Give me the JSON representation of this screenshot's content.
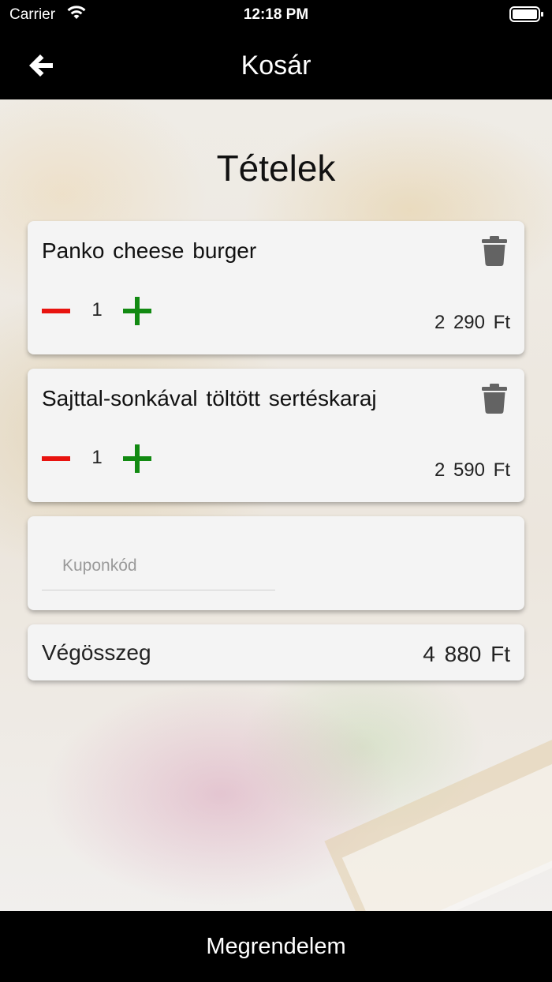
{
  "status": {
    "carrier": "Carrier",
    "time": "12:18 PM"
  },
  "navbar": {
    "title": "Kosár",
    "back_icon": "arrow-left-icon"
  },
  "cart": {
    "title": "Tételek",
    "items": [
      {
        "name": "Panko cheese burger",
        "quantity": "1",
        "price": "2 290 Ft"
      },
      {
        "name": "Sajttal-sonkával töltött sertéskaraj",
        "quantity": "1",
        "price": "2 590 Ft"
      }
    ],
    "coupon": {
      "placeholder": "Kuponkód",
      "value": ""
    },
    "total": {
      "label": "Végösszeg",
      "value": "4 880 Ft"
    }
  },
  "order_button": {
    "label": "Megrendelem"
  },
  "colors": {
    "bar_background": "#000000",
    "minus": "#e8130f",
    "plus": "#128a12",
    "trash": "#636363",
    "card_background": "#f4f4f4"
  },
  "icons": [
    "wifi-icon",
    "battery-icon",
    "arrow-left-icon",
    "trash-icon",
    "minus-icon",
    "plus-icon"
  ]
}
